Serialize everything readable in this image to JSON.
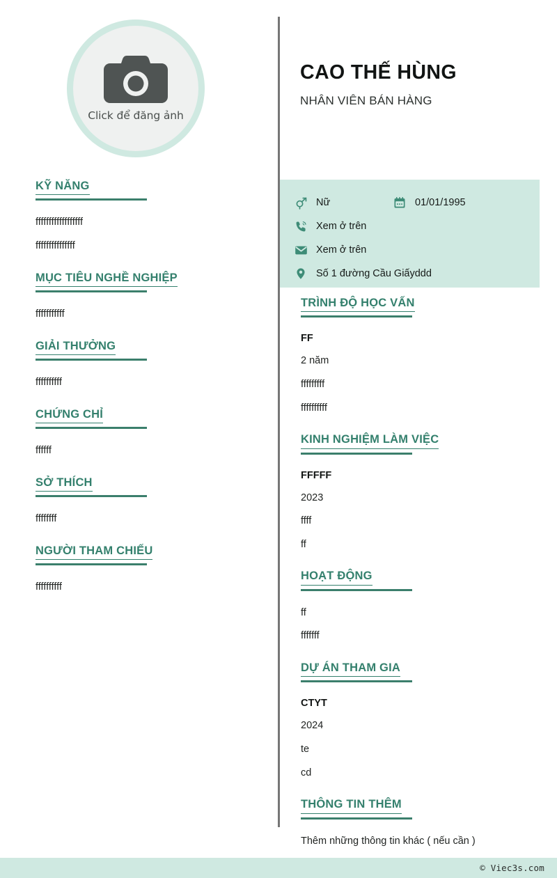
{
  "colors": {
    "accent": "#34806d",
    "accent_rule": "#3b7f6c",
    "mint": "#cfe9e1",
    "photo_bg": "#eff1f0",
    "divider": "#767676",
    "text": "#1f2220"
  },
  "photo": {
    "label": "Click để đăng ảnh",
    "icon": "camera-icon"
  },
  "header": {
    "name": "CAO THẾ HÙNG",
    "role": "NHÂN VIÊN BÁN HÀNG"
  },
  "contact": {
    "gender": {
      "icon": "gender-icon",
      "value": "Nữ"
    },
    "birthday": {
      "icon": "calendar-icon",
      "value": "01/01/1995"
    },
    "phone": {
      "icon": "phone-icon",
      "value": "Xem ở trên"
    },
    "email": {
      "icon": "mail-icon",
      "value": "Xem ở trên"
    },
    "address": {
      "icon": "location-pin-icon",
      "value": "Số 1 đường Cầu Giấyddd"
    }
  },
  "left_sections": [
    {
      "heading": "KỸ NĂNG",
      "lines": [
        "ffffffffffffffffff",
        "fffffffffffffff"
      ]
    },
    {
      "heading": "MỤC TIÊU NGHỀ NGHIỆP",
      "lines": [
        "fffffffffff"
      ]
    },
    {
      "heading": "GIẢI THƯỞNG",
      "lines": [
        "ffffffffff"
      ]
    },
    {
      "heading": "CHỨNG CHỈ",
      "lines": [
        "ffffff"
      ]
    },
    {
      "heading": "SỞ THÍCH",
      "lines": [
        "ffffffff"
      ]
    },
    {
      "heading": "NGƯỜI THAM CHIẾU",
      "lines": [
        "ffffffffff"
      ]
    }
  ],
  "right_sections": [
    {
      "heading": "TRÌNH ĐỘ HỌC VẤN",
      "entry_title": "FF",
      "lines": [
        "2 năm",
        "fffffffff",
        "ffffffffff"
      ]
    },
    {
      "heading": "KINH NGHIỆM LÀM VIỆC",
      "entry_title": "FFFFF",
      "lines": [
        "2023",
        "ffff",
        "ff"
      ]
    },
    {
      "heading": "HOẠT ĐỘNG",
      "entry_title": "",
      "lines": [
        "ff",
        "fffffff"
      ]
    },
    {
      "heading": "DỰ ÁN THAM GIA",
      "entry_title": "CTYT",
      "lines": [
        "2024",
        "te",
        "cd"
      ]
    },
    {
      "heading": "THÔNG TIN THÊM",
      "entry_title": "",
      "lines": [
        "Thêm những thông tin khác ( nếu cần )"
      ]
    }
  ],
  "footer": {
    "text": "© Viec3s.com"
  }
}
